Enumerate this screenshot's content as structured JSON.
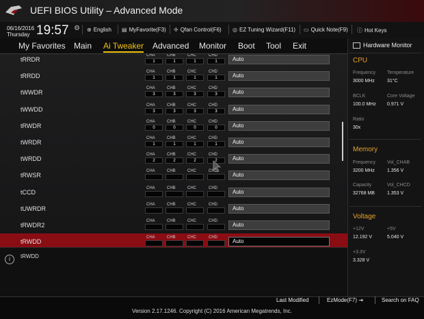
{
  "window": {
    "title": "UEFI BIOS Utility – Advanced Mode"
  },
  "infobar": {
    "date": "06/16/2016",
    "day": "Thursday",
    "time": "19:57",
    "tools": [
      "English",
      "MyFavorite(F3)",
      "Qfan Control(F6)",
      "EZ Tuning Wizard(F11)",
      "Quick Note(F9)",
      "Hot Keys"
    ]
  },
  "menu": [
    "My Favorites",
    "Main",
    "Ai Tweaker",
    "Advanced",
    "Monitor",
    "Boot",
    "Tool",
    "Exit"
  ],
  "active_menu": "Ai Tweaker",
  "channel_labels": [
    "CHA",
    "CHB",
    "CHC",
    "CHD"
  ],
  "rows": [
    {
      "label": "tRRDR",
      "values": [
        "1",
        "1",
        "1",
        "1"
      ],
      "setting": "Auto"
    },
    {
      "label": "tRRDD",
      "values": [
        "1",
        "1",
        "1",
        "1"
      ],
      "setting": "Auto"
    },
    {
      "label": "tWWDR",
      "values": [
        "3",
        "3",
        "3",
        "3"
      ],
      "setting": "Auto"
    },
    {
      "label": "tWWDD",
      "values": [
        "3",
        "3",
        "3",
        "3"
      ],
      "setting": "Auto"
    },
    {
      "label": "tRWDR",
      "values": [
        "0",
        "0",
        "0",
        "0"
      ],
      "setting": "Auto"
    },
    {
      "label": "tWRDR",
      "values": [
        "1",
        "1",
        "1",
        "1"
      ],
      "setting": "Auto"
    },
    {
      "label": "tWRDD",
      "values": [
        "2",
        "2",
        "2",
        "2"
      ],
      "setting": "Auto"
    },
    {
      "label": "tRWSR",
      "values": [
        "",
        "",
        "",
        ""
      ],
      "setting": "Auto"
    },
    {
      "label": "tCCD",
      "values": [
        "",
        "",
        "",
        ""
      ],
      "setting": "Auto"
    },
    {
      "label": "tUWRDR",
      "values": [
        "",
        "",
        "",
        ""
      ],
      "setting": "Auto"
    },
    {
      "label": "tRWDR2",
      "values": [
        "",
        "",
        "",
        ""
      ],
      "setting": "Auto"
    },
    {
      "label": "tRWDD",
      "values": [
        "",
        "",
        "",
        ""
      ],
      "setting": "Auto",
      "selected": true
    }
  ],
  "help": {
    "text": "tRWDD"
  },
  "hardware_monitor": {
    "title": "Hardware Monitor",
    "cpu": {
      "title": "CPU",
      "frequency_label": "Frequency",
      "frequency": "3000 MHz",
      "temperature_label": "Temperature",
      "temperature": "31°C",
      "bclk_label": "BCLK",
      "bclk": "100.0 MHz",
      "core_voltage_label": "Core Voltage",
      "core_voltage": "0.971 V",
      "ratio_label": "Ratio",
      "ratio": "30x"
    },
    "memory": {
      "title": "Memory",
      "frequency_label": "Frequency",
      "frequency": "3200 MHz",
      "vol_chab_label": "Vol_CHAB",
      "vol_chab": "1.356 V",
      "capacity_label": "Capacity",
      "capacity": "32768 MB",
      "vol_chcd_label": "Vol_CHCD",
      "vol_chcd": "1.353 V"
    },
    "voltage": {
      "title": "Voltage",
      "v12_label": "+12V",
      "v12": "12.192 V",
      "v5_label": "+5V",
      "v5": "5.040 V",
      "v33_label": "+3.3V",
      "v33": "3.328 V"
    }
  },
  "footer": {
    "last_modified": "Last Modified",
    "ez_mode": "EzMode(F7)",
    "search": "Search on FAQ",
    "version": "Version 2.17.1246. Copyright (C) 2016 American Megatrends, Inc."
  },
  "colors": {
    "accent": "#f1c40f",
    "selected_row": "#8a0d13",
    "monitor_section": "#e8a22a"
  }
}
